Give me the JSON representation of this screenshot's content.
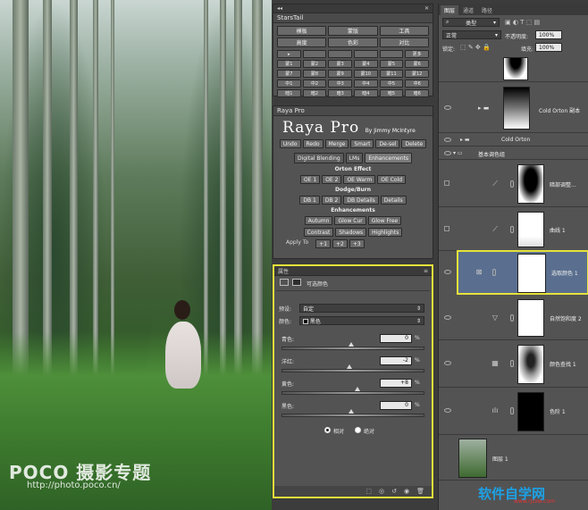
{
  "photo": {
    "watermark_logo": "POCO 摄影专题",
    "watermark_url": "http://photo.poco.cn/"
  },
  "starstail": {
    "title": "StarsTail",
    "row1": [
      "模板",
      "蒙版",
      "工具"
    ],
    "row2": [
      "高度",
      "色彩",
      "对比"
    ],
    "small": [
      "▸",
      "",
      "",
      "",
      "",
      "更多",
      "蒙1",
      "蒙2",
      "蒙3",
      "蒙4",
      "蒙5",
      "蒙6",
      "蒙7",
      "蒙8",
      "蒙9",
      "蒙10",
      "蒙11",
      "蒙12",
      "中1",
      "中2",
      "中3",
      "中4",
      "中5",
      "中6",
      "暗1",
      "暗2",
      "暗3",
      "暗4",
      "暗5",
      "暗6"
    ]
  },
  "raya": {
    "title": "Raya Pro",
    "logo": "Raya Pro",
    "byline": "By Jimmy McIntyre",
    "row1": [
      "Undo",
      "Redo",
      "Merge",
      "Smart",
      "De-sel",
      "Delete"
    ],
    "tabs": [
      "Digital Blending",
      "LMs",
      "Enhancements"
    ],
    "orton_title": "Orton Effect",
    "orton": [
      "OE 1",
      "OE 2",
      "OE Warm",
      "OE Cold"
    ],
    "dodge_title": "Dodge/Burn",
    "dodge": [
      "DB 1",
      "DB 2",
      "DB Details",
      "Details"
    ],
    "enh_title": "Enhancements",
    "enh1": [
      "Autumn",
      "Glow Cur",
      "Glow Free"
    ],
    "enh2": [
      "Contrast",
      "Shadows",
      "Highlights"
    ],
    "apply": "Apply To",
    "apply_btns": [
      "+1",
      "+2",
      "+3"
    ]
  },
  "props": {
    "title": "属性",
    "subtitle": "可选颜色",
    "preset_label": "预设:",
    "preset_value": "自定",
    "colors_label": "颜色:",
    "colors_value": "黑色",
    "cyan_label": "青色:",
    "cyan_value": "0",
    "magenta_label": "洋红:",
    "magenta_value": "-2",
    "yellow_label": "黄色:",
    "yellow_value": "+8",
    "black_label": "黑色:",
    "black_value": "0",
    "pct": "%",
    "relative": "相对",
    "absolute": "绝对"
  },
  "layers": {
    "tabs": [
      "图层",
      "通道",
      "路径"
    ],
    "kind": "类型",
    "blend": "正常",
    "opacity_label": "不透明度:",
    "opacity": "100%",
    "lock_label": "锁定:",
    "fill_label": "填充:",
    "fill": "100%",
    "items": [
      {
        "name": "Cold Orton 副本"
      },
      {
        "name": "Cold Orton"
      },
      {
        "name": "基本调色组"
      },
      {
        "name": "暗部调整..."
      },
      {
        "name": "曲线 1"
      },
      {
        "name": "选取颜色 1"
      },
      {
        "name": "自然饱和度 2"
      },
      {
        "name": "颜色查找 1"
      },
      {
        "name": "色阶 1"
      },
      {
        "name": "图层 1"
      }
    ]
  },
  "logo2": {
    "main": "软件自学网",
    "sub": "www.rjzxw.com"
  }
}
